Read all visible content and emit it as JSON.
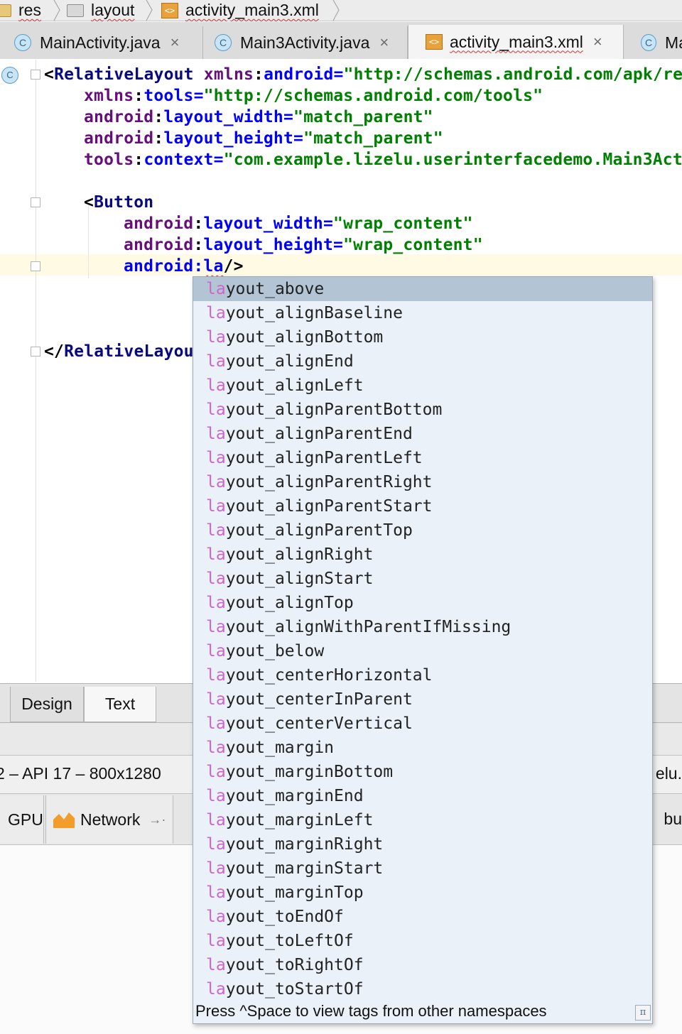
{
  "breadcrumbs": [
    "res",
    "layout",
    "activity_main3.xml"
  ],
  "tabs": [
    {
      "label": "MainActivity.java",
      "close": "×"
    },
    {
      "label": "Main3Activity.java",
      "close": "×"
    },
    {
      "label": "activity_main3.xml",
      "close": "×",
      "active": true
    },
    {
      "label": "Ma"
    }
  ],
  "code": {
    "line1": {
      "tag": "RelativeLayout",
      "ns": "xmlns",
      "attr": "android",
      "value": "\"http://schemas.android.com/apk/re"
    },
    "line2": {
      "ns": "xmlns",
      "attr": "tools",
      "value": "\"http://schemas.android.com/tools\""
    },
    "line3": {
      "ns": "android",
      "attr": "layout_width",
      "value": "\"match_parent\""
    },
    "line4": {
      "ns": "android",
      "attr": "layout_height",
      "value": "\"match_parent\""
    },
    "line5": {
      "ns": "tools",
      "attr": "context",
      "value": "\"com.example.lizelu.userinterfacedemo.Main3Act"
    },
    "line7": {
      "tag": "Button"
    },
    "line8": {
      "ns": "android",
      "attr": "layout_width",
      "value": "\"wrap_content\""
    },
    "line9": {
      "ns": "android",
      "attr": "layout_height",
      "value": "\"wrap_content\""
    },
    "line10": {
      "ns": "android",
      "typed": "la",
      "close": "/>"
    },
    "line14": {
      "tag": "RelativeLayou"
    }
  },
  "editor_tabs": {
    "design": "Design",
    "text": "Text"
  },
  "device_bar": {
    "left": "2 – API 17 – 800x1280",
    "right": "elu."
  },
  "monitor": {
    "gpu": "GPU",
    "network": "Network",
    "right": "bu"
  },
  "completion": {
    "prefix": "la",
    "items": [
      "layout_above",
      "layout_alignBaseline",
      "layout_alignBottom",
      "layout_alignEnd",
      "layout_alignLeft",
      "layout_alignParentBottom",
      "layout_alignParentEnd",
      "layout_alignParentLeft",
      "layout_alignParentRight",
      "layout_alignParentStart",
      "layout_alignParentTop",
      "layout_alignRight",
      "layout_alignStart",
      "layout_alignTop",
      "layout_alignWithParentIfMissing",
      "layout_below",
      "layout_centerHorizontal",
      "layout_centerInParent",
      "layout_centerVertical",
      "layout_margin",
      "layout_marginBottom",
      "layout_marginEnd",
      "layout_marginLeft",
      "layout_marginRight",
      "layout_marginStart",
      "layout_marginTop",
      "layout_toEndOf",
      "layout_toLeftOf",
      "layout_toRightOf",
      "layout_toStartOf"
    ],
    "selected_index": 0,
    "footer": "Press ^Space to view tags from other namespaces",
    "pi_symbol": "π"
  }
}
